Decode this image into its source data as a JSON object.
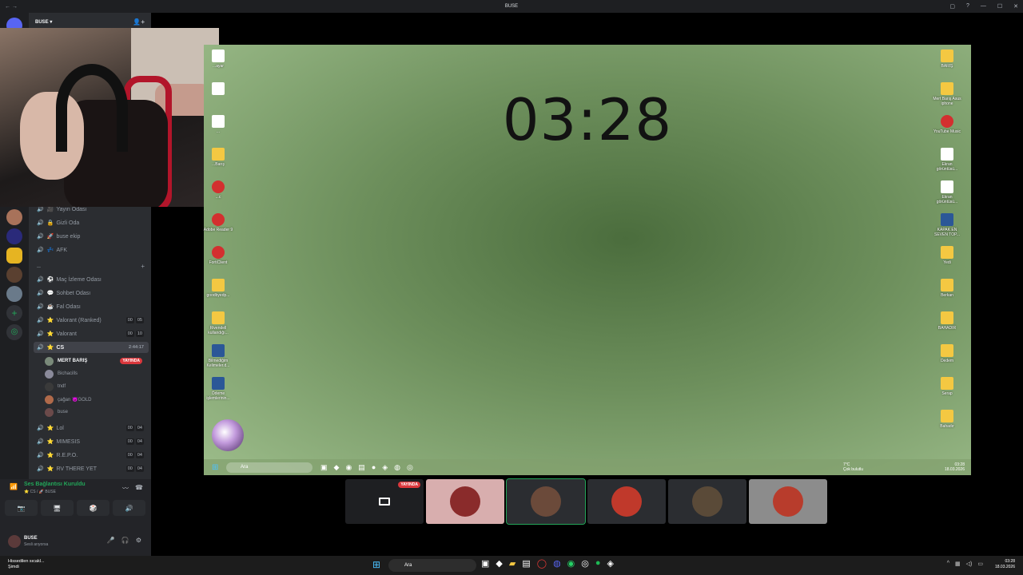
{
  "window": {
    "title": "BUSE",
    "nav": "← →",
    "controls": [
      "▢",
      "?",
      "—",
      "☐",
      "✕"
    ]
  },
  "guild": {
    "name": "BUSE ▾",
    "add_icon": "person-add-icon"
  },
  "channels_top": [
    {
      "label": "Yayın Odası",
      "icon": "🎥"
    },
    {
      "label": "Gizli Oda",
      "icon": "🔒"
    },
    {
      "label": "buse ekip",
      "icon": "🚀"
    },
    {
      "label": "AFK",
      "icon": "💤"
    }
  ],
  "channels_main": [
    {
      "label": "Maç İzleme Odası",
      "icon": "⚽"
    },
    {
      "label": "Sohbet Odası",
      "icon": "💬"
    },
    {
      "label": "Fal Odası",
      "icon": "☕"
    },
    {
      "label": "Valorant (Ranked)",
      "icon": "⭐",
      "count": [
        "00",
        "05"
      ]
    },
    {
      "label": "Valorant",
      "icon": "⭐",
      "count": [
        "00",
        "10"
      ]
    },
    {
      "label": "CS",
      "icon": "⭐",
      "timer": "2:44:17",
      "active": true
    }
  ],
  "cs_users": [
    {
      "name": "MERT BARIŞ",
      "live": "YAYINDA",
      "bold": true
    },
    {
      "name": "Bichacills"
    },
    {
      "name": "tndf"
    },
    {
      "name": "çağan 😈GOLD"
    },
    {
      "name": "buse"
    }
  ],
  "channels_bottom": [
    {
      "label": "Lol",
      "icon": "⭐",
      "count": [
        "00",
        "04"
      ]
    },
    {
      "label": "MIMESIS",
      "icon": "⭐",
      "count": [
        "00",
        "04"
      ]
    },
    {
      "label": "R.E.P.O.",
      "icon": "⭐",
      "count": [
        "00",
        "04"
      ]
    },
    {
      "label": "RV THERE YET",
      "icon": "⭐",
      "count": [
        "00",
        "04"
      ]
    }
  ],
  "voice": {
    "status": "Ses Bağlantısı Kuruldu",
    "sub": "⭐ CS / 🚀 BUSE"
  },
  "user": {
    "name": "BUSE",
    "status": "Sesli arıyorsa"
  },
  "stream": {
    "clock": "03:28",
    "left_icons": [
      {
        "label": "...ayar",
        "cls": "doc"
      },
      {
        "label": "",
        "cls": "doc"
      },
      {
        "label": "...",
        "cls": "doc"
      },
      {
        "label": "...Barış",
        "cls": "folder"
      },
      {
        "label": "...c",
        "cls": "red"
      },
      {
        "label": "Adobe Reader 9",
        "cls": "red"
      },
      {
        "label": "FortiClient",
        "cls": "red"
      },
      {
        "label": "goodbyedp...",
        "cls": "folder"
      },
      {
        "label": "Rivendell kullandığı...",
        "cls": "folder"
      },
      {
        "label": "Bilmediğim Kelimeler.d...",
        "cls": "word"
      },
      {
        "label": "Ödeme işlemlerinin...",
        "cls": "word"
      }
    ],
    "right_icons": [
      {
        "label": "BARIŞ",
        "cls": "folder"
      },
      {
        "label": "Mert Barış Asus iphone",
        "cls": "folder"
      },
      {
        "label": "YouTube Music",
        "cls": "red"
      },
      {
        "label": "Ekran görüntüsü...",
        "cls": "doc"
      },
      {
        "label": "Ekran görüntüsü...",
        "cls": "doc"
      },
      {
        "label": "KAPAK EN SEVEN TOP...",
        "cls": "word"
      },
      {
        "label": "Yedi",
        "cls": "folder"
      },
      {
        "label": "Berkan",
        "cls": "folder"
      },
      {
        "label": "BAHADIR",
        "cls": "folder"
      },
      {
        "label": "Dedem",
        "cls": "folder"
      },
      {
        "label": "Serap",
        "cls": "folder"
      },
      {
        "label": "Bahadır",
        "cls": "folder"
      }
    ],
    "taskbar": {
      "search": "Ara",
      "weather_temp": "7°C",
      "weather_desc": "Çok bulutlu",
      "time": "03:28",
      "date": "18.03.2026"
    }
  },
  "tiles": [
    {
      "type": "screen",
      "live": "YAYINDA"
    },
    {
      "type": "avatar",
      "bg": "pink",
      "color": "#8a2b2b"
    },
    {
      "type": "avatar",
      "bg": "dark",
      "color": "#6b4a3a",
      "selected": true
    },
    {
      "type": "avatar",
      "bg": "dark",
      "color": "#c0392b"
    },
    {
      "type": "avatar",
      "bg": "dark",
      "color": "#5a4a38"
    },
    {
      "type": "avatar",
      "bg": "grey",
      "color": "#b83c2c"
    }
  ],
  "os_taskbar": {
    "news_title": "Hissedilen sıcakl...",
    "news_sub": "Şimdi",
    "search": "Ara",
    "time": "03:28",
    "date": "18.03.2026"
  }
}
